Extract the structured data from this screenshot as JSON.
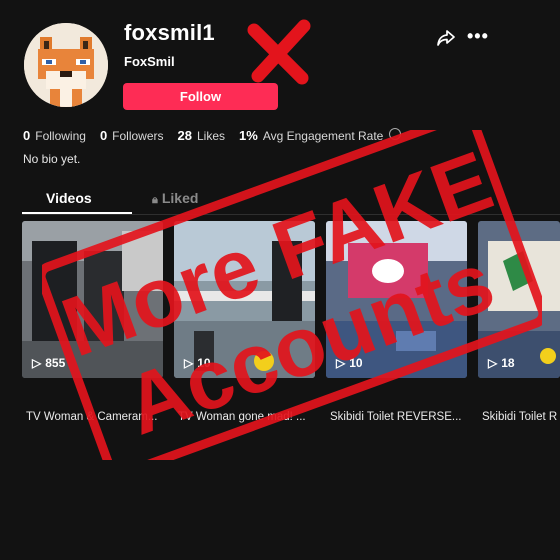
{
  "profile": {
    "username": "foxsmil1",
    "nickname": "FoxSmil",
    "follow_label": "Follow",
    "bio": "No bio yet."
  },
  "stats": [
    {
      "value": "0",
      "label": "Following"
    },
    {
      "value": "0",
      "label": "Followers"
    },
    {
      "value": "28",
      "label": "Likes"
    },
    {
      "value": "1%",
      "label": "Avg Engagement Rate"
    }
  ],
  "tabs": {
    "videos": "Videos",
    "liked": "Liked"
  },
  "videos": [
    {
      "views": "855",
      "caption": "TV Woman & Cameram..."
    },
    {
      "views": "10",
      "caption": "TV Woman gone mad! ..."
    },
    {
      "views": "10",
      "caption": "Skibidi Toilet REVERSE..."
    },
    {
      "views": "18",
      "caption": "Skibidi Toilet R"
    }
  ],
  "stamp": {
    "line1": "More FAKE",
    "line2": "Accounts"
  },
  "colors": {
    "accent": "#fe2c55",
    "stamp": "#e3141c",
    "background": "#121212"
  },
  "icons": {
    "share": "share-icon",
    "more": "more-icon",
    "play": "play-icon",
    "lock": "lock-icon"
  }
}
